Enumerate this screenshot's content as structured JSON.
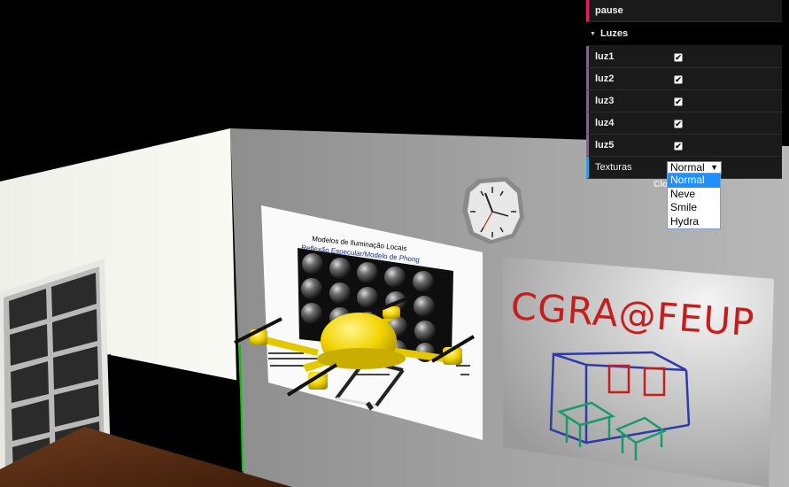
{
  "gui": {
    "pause_label": "pause",
    "lights_folder": "Luzes",
    "lights": [
      {
        "label": "luz1",
        "checked": true
      },
      {
        "label": "luz2",
        "checked": true
      },
      {
        "label": "luz3",
        "checked": true
      },
      {
        "label": "luz4",
        "checked": true
      },
      {
        "label": "luz5",
        "checked": true
      }
    ],
    "textures_label": "Texturas",
    "textures_selected": "Normal",
    "textures_options": [
      "Normal",
      "Neve",
      "Smile",
      "Hydra"
    ],
    "close_label": "Clo"
  },
  "scene": {
    "poster_title": "Modelos de Iluminação Locais",
    "poster_subtitle": "Reflexão Especular/Modelo de Phong",
    "whiteboard_text": "CGRA@FEUP"
  }
}
